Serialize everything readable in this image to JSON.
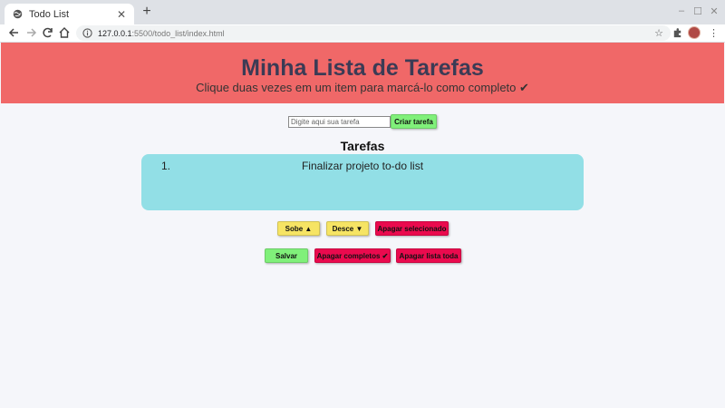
{
  "browser": {
    "tab_title": "Todo List",
    "new_tab_label": "+",
    "url_host": "127.0.0.1",
    "url_rest": ":5500/todo_list/index.html"
  },
  "header": {
    "title": "Minha Lista de Tarefas",
    "subtitle": "Clique duas vezes em um item para marcá-lo como completo ✔"
  },
  "form": {
    "placeholder": "Digite aqui sua tarefa",
    "create_label": "Criar tarefa"
  },
  "list": {
    "title": "Tarefas",
    "items": [
      {
        "number": "1.",
        "text": "Finalizar projeto to-do list"
      }
    ]
  },
  "actions": {
    "up_label": "Sobe ▲",
    "down_label": "Desce ▼",
    "delete_selected_label": "Apagar selecionado",
    "save_label": "Salvar",
    "delete_completed_label": "Apagar completos ✔",
    "delete_all_label": "Apagar lista toda"
  },
  "colors": {
    "header_bg": "#f06868",
    "list_bg": "#92dfe6",
    "green_button": "#80f07a",
    "yellow_button": "#f6e464",
    "red_button": "#ea0a4e"
  }
}
